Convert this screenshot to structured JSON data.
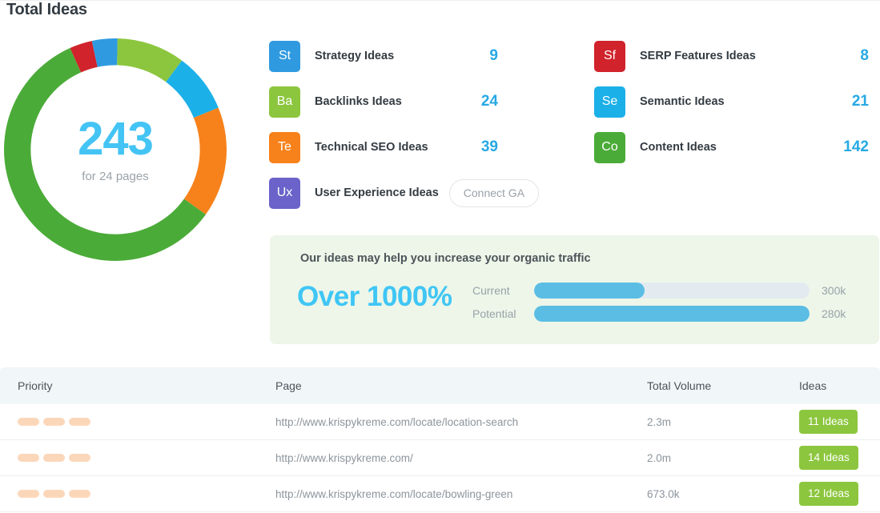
{
  "page": {
    "title": "Total Ideas"
  },
  "donut": {
    "total": "243",
    "subtitle": "for 24 pages"
  },
  "chart_data": {
    "type": "pie",
    "title": "Total Ideas",
    "total": 243,
    "subtitle": "for 24 pages",
    "categories": [
      "SERP Features Ideas",
      "Strategy Ideas",
      "Backlinks Ideas",
      "Semantic Ideas",
      "Technical SEO Ideas",
      "Content Ideas"
    ],
    "values": [
      8,
      9,
      24,
      21,
      39,
      142
    ],
    "colors": [
      "#d0232b",
      "#2f9ae0",
      "#8cc63e",
      "#1cb0e8",
      "#f7821b",
      "#4bab38"
    ],
    "start_angle_deg": -24,
    "donut_hole_ratio": 0.76,
    "legend_position": "right",
    "grid": false
  },
  "legend": {
    "left": [
      {
        "abbr": "St",
        "label": "Strategy Ideas",
        "value": "9",
        "color": "#2f9ae0",
        "icon": "strategy-ideas-icon"
      },
      {
        "abbr": "Ba",
        "label": "Backlinks Ideas",
        "value": "24",
        "color": "#8cc63e",
        "icon": "backlinks-ideas-icon"
      },
      {
        "abbr": "Te",
        "label": "Technical SEO Ideas",
        "value": "39",
        "color": "#f7821b",
        "icon": "technical-seo-ideas-icon"
      },
      {
        "abbr": "Ux",
        "label": "User Experience Ideas",
        "value": "",
        "color": "#6b63c9",
        "icon": "user-experience-ideas-icon",
        "button": "Connect GA"
      }
    ],
    "right": [
      {
        "abbr": "Sf",
        "label": "SERP Features Ideas",
        "value": "8",
        "color": "#d0232b",
        "icon": "serp-features-ideas-icon"
      },
      {
        "abbr": "Se",
        "label": "Semantic Ideas",
        "value": "21",
        "color": "#1cb0e8",
        "icon": "semantic-ideas-icon"
      },
      {
        "abbr": "Co",
        "label": "Content Ideas",
        "value": "142",
        "color": "#4bab38",
        "icon": "content-ideas-icon"
      }
    ]
  },
  "traffic": {
    "headline": "Our ideas may help you increase your organic traffic",
    "percent": "Over 1000%",
    "bars": [
      {
        "name": "Current",
        "value": "300k",
        "fill_pct": 40
      },
      {
        "name": "Potential",
        "value": "280k",
        "fill_pct": 100
      }
    ],
    "accent_color": "#3fc6f5",
    "bar_color": "#5bbde4",
    "panel_color": "#edf6e9"
  },
  "table": {
    "columns": [
      "Priority",
      "Page",
      "Total Volume",
      "Ideas"
    ],
    "rows": [
      {
        "priority_segments": 3,
        "page": "http://www.krispykreme.com/locate/location-search",
        "volume": "2.3m",
        "ideas": "11 Ideas"
      },
      {
        "priority_segments": 3,
        "page": "http://www.krispykreme.com/",
        "volume": "2.0m",
        "ideas": "14 Ideas"
      },
      {
        "priority_segments": 3,
        "page": "http://www.krispykreme.com/locate/bowling-green",
        "volume": "673.0k",
        "ideas": "12 Ideas"
      }
    ],
    "priority_color": "#fbd7ba",
    "badge_color": "#8cc63e"
  }
}
